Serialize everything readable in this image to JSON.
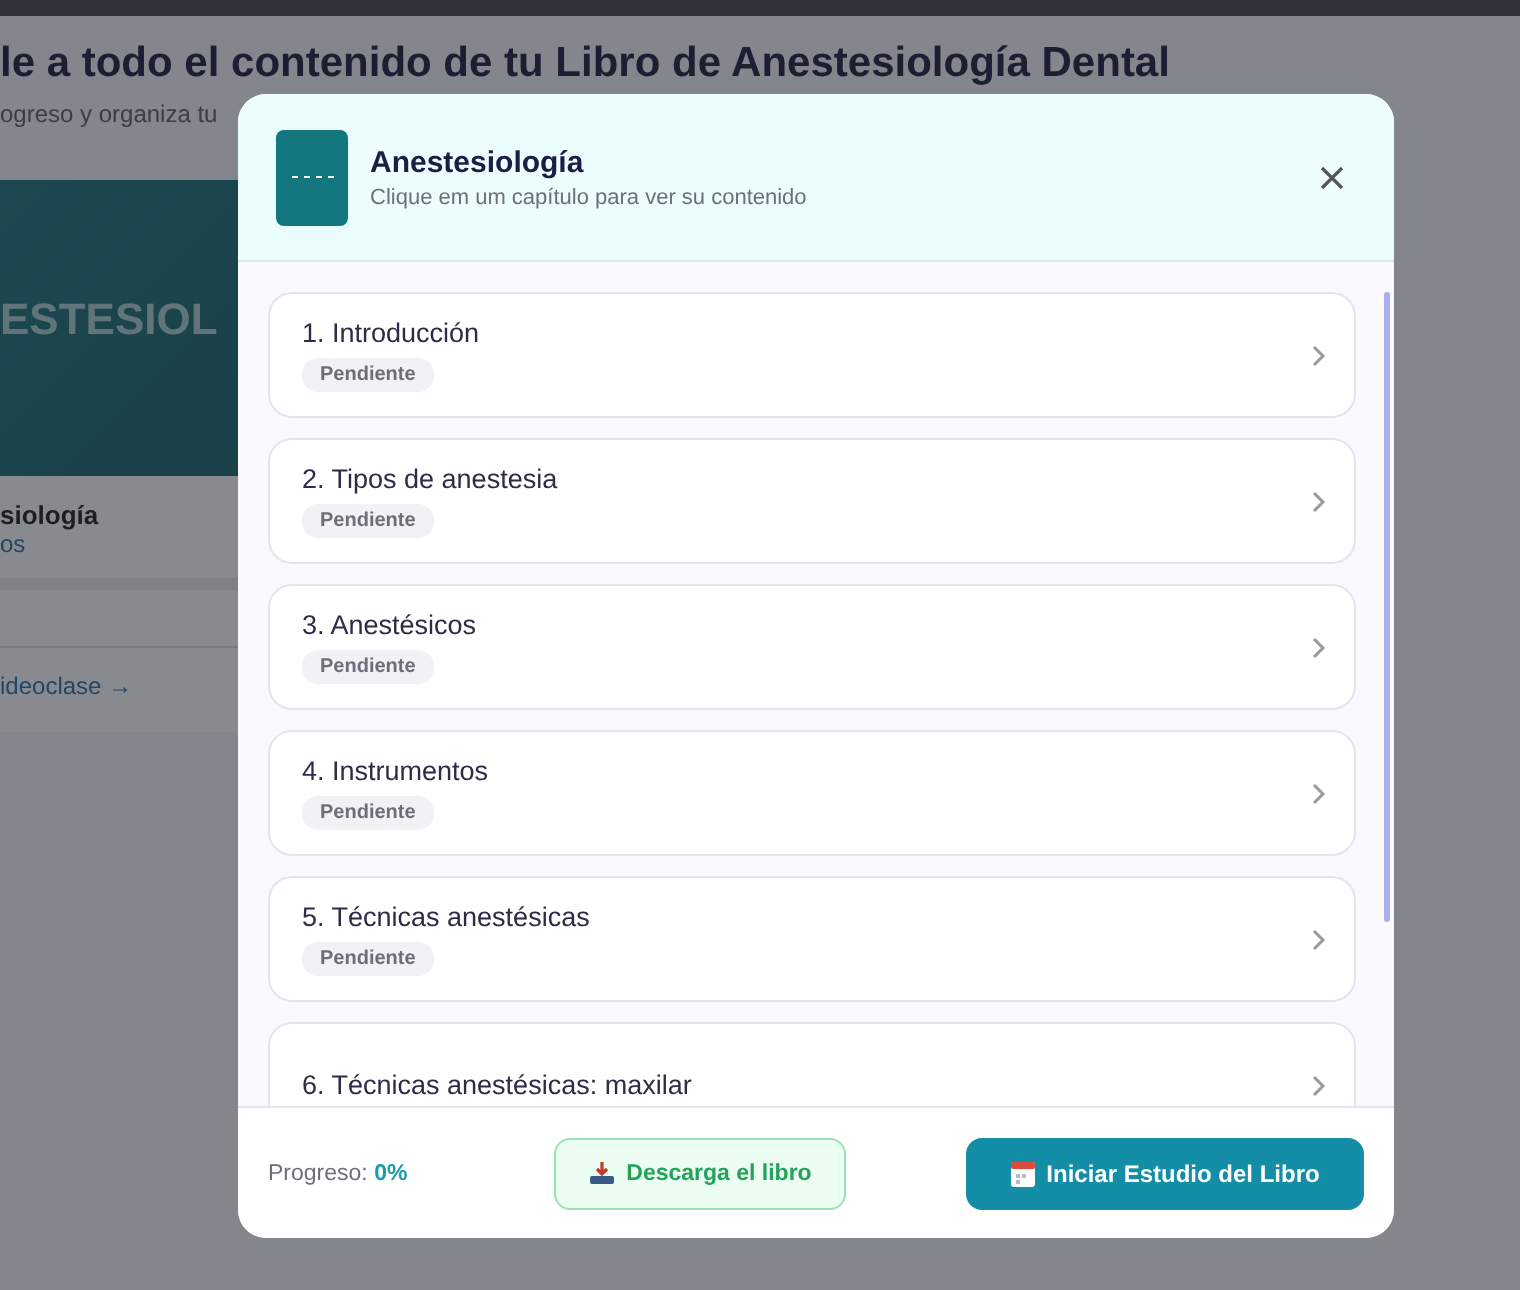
{
  "page": {
    "heading": "le a todo el contenido de tu Libro de Anestesiología Dental",
    "subheading": "ogreso y organiza tu",
    "card": {
      "cover_text": "ESTESIOL",
      "title": "siología",
      "subtitle": "os",
      "link": "ideoclase →"
    }
  },
  "modal": {
    "title": "Anestesiología",
    "subtitle": "Clique em um capítulo para ver su contenido",
    "chapters": [
      {
        "title": "1. Introducción",
        "status": "Pendiente"
      },
      {
        "title": "2. Tipos de anestesia",
        "status": "Pendiente"
      },
      {
        "title": "3. Anestésicos",
        "status": "Pendiente"
      },
      {
        "title": "4. Instrumentos",
        "status": "Pendiente"
      },
      {
        "title": "5. Técnicas anestésicas",
        "status": "Pendiente"
      },
      {
        "title": "6. Técnicas anestésicas: maxilar"
      }
    ],
    "progress_label": "Progreso:",
    "progress_value": "0%",
    "download_button": "Descarga el libro",
    "start_button": "Iniciar Estudio del Libro"
  }
}
